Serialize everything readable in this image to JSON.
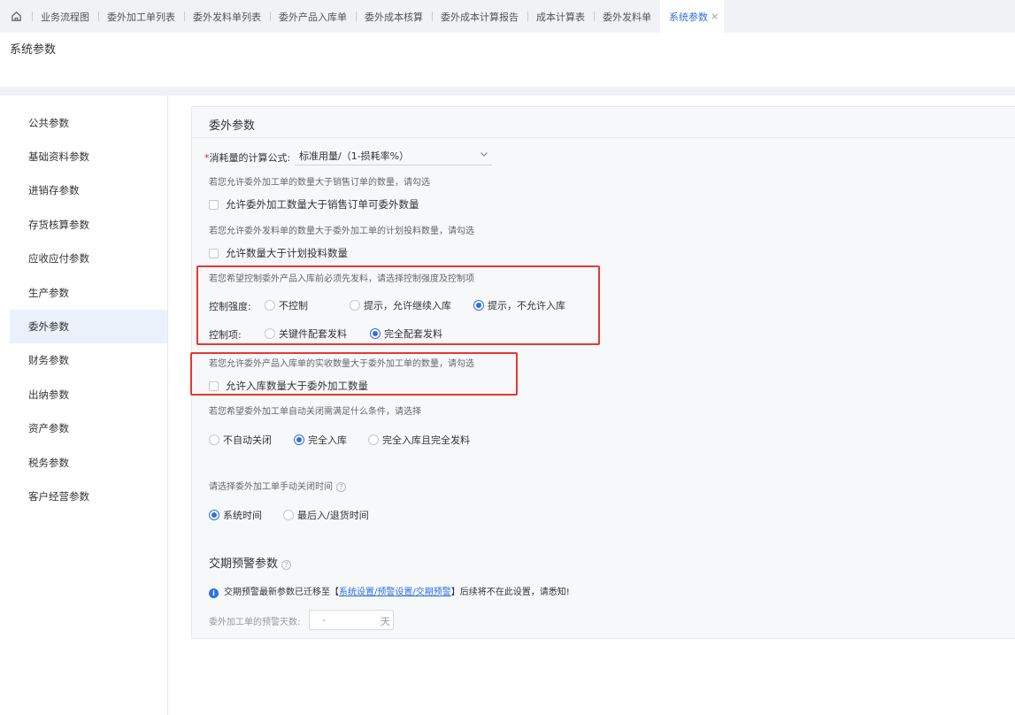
{
  "tabs": [
    {
      "label": "业务流程图"
    },
    {
      "label": "委外加工单列表"
    },
    {
      "label": "委外发料单列表"
    },
    {
      "label": "委外产品入库单"
    },
    {
      "label": "委外成本核算"
    },
    {
      "label": "委外成本计算报告"
    },
    {
      "label": "成本计算表"
    },
    {
      "label": "委外发料单"
    },
    {
      "label": "系统参数",
      "active": true
    }
  ],
  "tab_close": "×",
  "page_title": "系统参数",
  "sidebar": {
    "items": [
      {
        "label": "公共参数"
      },
      {
        "label": "基础资料参数"
      },
      {
        "label": "进销存参数"
      },
      {
        "label": "存货核算参数"
      },
      {
        "label": "应收应付参数"
      },
      {
        "label": "生产参数"
      },
      {
        "label": "委外参数",
        "active": true
      },
      {
        "label": "财务参数"
      },
      {
        "label": "出纳参数"
      },
      {
        "label": "资产参数"
      },
      {
        "label": "税务参数"
      },
      {
        "label": "客户经营参数"
      }
    ]
  },
  "main": {
    "section_title": "委外参数",
    "formula": {
      "required_mark": "*",
      "label": "消耗量的计算公式:",
      "value": "标准用量/（1-损耗率%）"
    },
    "hint1": "若您允许委外加工单的数量大于销售订单的数量，请勾选",
    "checkbox1": "允许委外加工数量大于销售订单可委外数量",
    "hint2": "若您允许委外发料单的数量大于委外加工单的计划投料数量，请勾选",
    "checkbox2": "允许数量大于计划投料数量",
    "hint3": "若您希望控制委外产品入库前必须先发料，请选择控制强度及控制项",
    "control_strength": {
      "label": "控制强度:",
      "options": [
        "不控制",
        "提示，允许继续入库",
        "提示，不允许入库"
      ],
      "selected": "提示，不允许入库"
    },
    "control_item": {
      "label": "控制项:",
      "options": [
        "关键件配套发料",
        "完全配套发料"
      ],
      "selected": "完全配套发料"
    },
    "hint4": "若您允许委外产品入库单的实收数量大于委外加工单的数量，请勾选",
    "checkbox3": "允许入库数量大于委外加工数量",
    "hint5": "若您希望委外加工单自动关闭需满足什么条件，请选择",
    "auto_close": {
      "options": [
        "不自动关闭",
        "完全入库",
        "完全入库且完全发料"
      ],
      "selected": "完全入库"
    },
    "hint6": "请选择委外加工单手动关闭时间",
    "manual_close": {
      "options": [
        "系统时间",
        "最后入/退货时间"
      ],
      "selected": "系统时间"
    },
    "warning_section_title": "交期预警参数",
    "notice_prefix": "交期预警最新参数已迁移至【",
    "notice_link": "系统设置/预警设置/交期预警",
    "notice_suffix": "】后续将不在此设置，请悉知!",
    "warning_days_label": "委外加工单的预警天数:",
    "warning_days_value": "-",
    "warning_days_unit": "天"
  },
  "colors": {
    "accent": "#2f6fe4",
    "highlight_box": "#e53935"
  }
}
